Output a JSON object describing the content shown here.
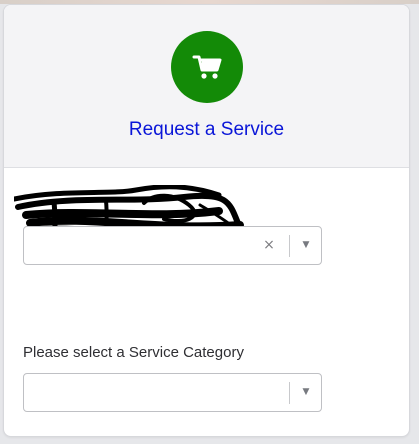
{
  "header": {
    "title": "Request a Service",
    "icon": "shopping-cart-icon",
    "icon_bg_color": "#138a07",
    "title_color": "#0a16d8"
  },
  "first_field": {
    "value": "",
    "clear_glyph": "×",
    "arrow_glyph": "▼"
  },
  "category": {
    "label": "Please select a Service Category",
    "value": "",
    "arrow_glyph": "▼"
  }
}
